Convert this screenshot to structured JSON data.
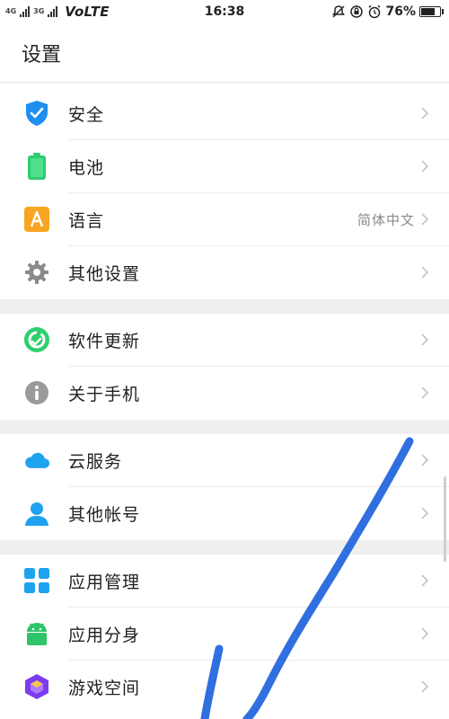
{
  "statusbar": {
    "signal_left": "4G",
    "signal_right": "3G",
    "network": "VoLTE",
    "time": "16:38",
    "battery_text": "76%",
    "battery_level": 0.76
  },
  "header": {
    "title": "设置"
  },
  "sections": [
    {
      "items": [
        {
          "label": "安全",
          "icon": "shield-check-icon"
        },
        {
          "label": "电池",
          "icon": "battery-icon"
        },
        {
          "label": "语言",
          "icon": "language-icon",
          "value": "简体中文"
        },
        {
          "label": "其他设置",
          "icon": "gear-icon"
        }
      ]
    },
    {
      "items": [
        {
          "label": "软件更新",
          "icon": "update-icon"
        },
        {
          "label": "关于手机",
          "icon": "info-icon"
        }
      ]
    },
    {
      "items": [
        {
          "label": "云服务",
          "icon": "cloud-icon"
        },
        {
          "label": "其他帐号",
          "icon": "person-icon"
        }
      ]
    },
    {
      "items": [
        {
          "label": "应用管理",
          "icon": "app-grid-icon"
        },
        {
          "label": "应用分身",
          "icon": "android-icon"
        },
        {
          "label": "游戏空间",
          "icon": "game-cube-icon"
        }
      ]
    }
  ],
  "colors": {
    "shield": "#1e8ff0",
    "battery": "#2ecc71",
    "language": "#f6a623",
    "gear": "#8a8a8a",
    "update": "#2fcf6b",
    "info": "#9a9a9a",
    "cloud": "#1fa2f0",
    "person": "#1fa2f0",
    "apps": "#1fa2f0",
    "android": "#2ec46a",
    "game": "#7b3cf0",
    "annotation": "#2f6fe0"
  }
}
